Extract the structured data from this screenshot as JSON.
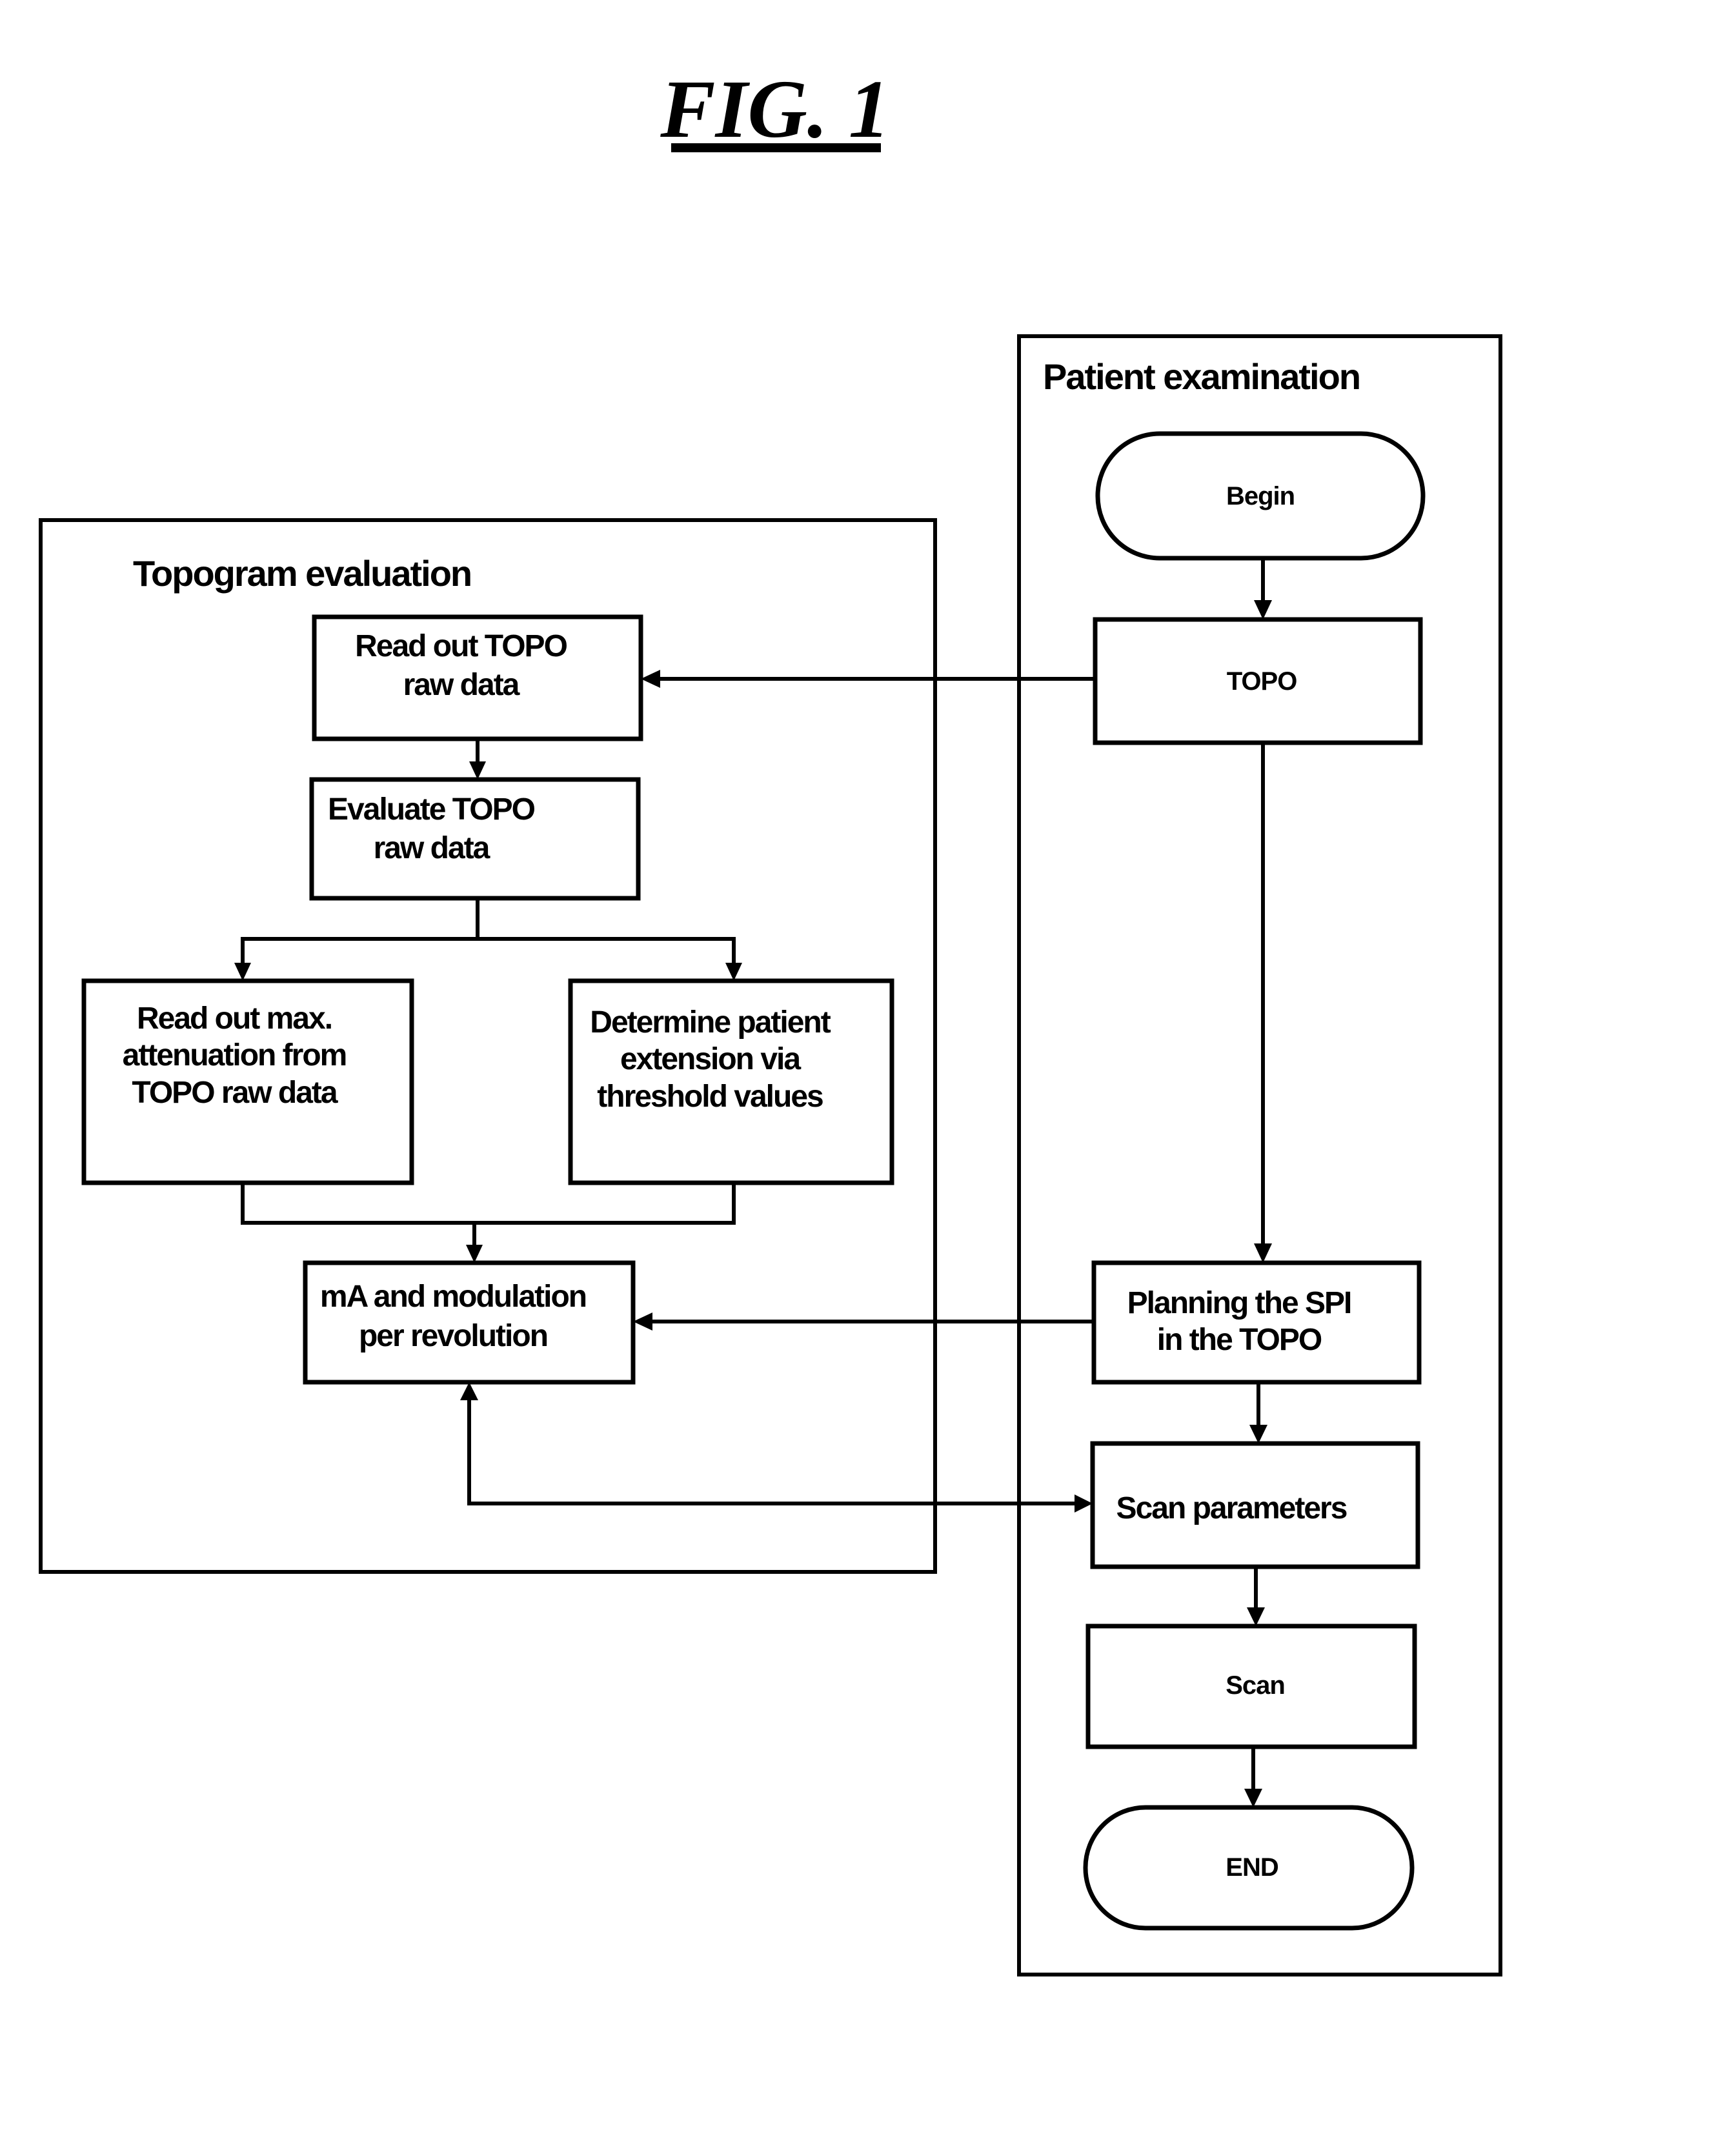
{
  "figure": {
    "title": "FIG. 1"
  },
  "panels": {
    "patient_examination": {
      "label": "Patient examination"
    },
    "topogram_evaluation": {
      "label": "Topogram evaluation"
    }
  },
  "nodes": {
    "begin": {
      "lines": [
        "Begin"
      ],
      "shape": "terminator"
    },
    "topo": {
      "lines": [
        "TOPO"
      ],
      "shape": "process"
    },
    "planning_spi": {
      "lines": [
        "Planning the SPI",
        "in the TOPO"
      ],
      "shape": "process"
    },
    "scan_parameters": {
      "lines": [
        "Scan parameters"
      ],
      "shape": "process"
    },
    "scan": {
      "lines": [
        "Scan"
      ],
      "shape": "process"
    },
    "end": {
      "lines": [
        "END"
      ],
      "shape": "terminator"
    },
    "read_out_topo_raw": {
      "lines": [
        "Read out TOPO",
        "raw data"
      ],
      "shape": "process"
    },
    "evaluate_topo_raw": {
      "lines": [
        "Evaluate TOPO",
        "raw data"
      ],
      "shape": "process"
    },
    "read_out_max_attenuation": {
      "lines": [
        "Read out max.",
        "attenuation from",
        "TOPO raw data"
      ],
      "shape": "process"
    },
    "determine_patient_extension": {
      "lines": [
        "Determine patient",
        "extension via",
        "threshold values"
      ],
      "shape": "process"
    },
    "ma_modulation": {
      "lines": [
        "mA and modulation",
        "per revolution"
      ],
      "shape": "process"
    }
  },
  "edges": [
    {
      "from": "begin",
      "to": "topo"
    },
    {
      "from": "topo",
      "to": "read_out_topo_raw"
    },
    {
      "from": "topo",
      "to": "planning_spi"
    },
    {
      "from": "read_out_topo_raw",
      "to": "evaluate_topo_raw"
    },
    {
      "from": "evaluate_topo_raw",
      "to": "read_out_max_attenuation"
    },
    {
      "from": "evaluate_topo_raw",
      "to": "determine_patient_extension"
    },
    {
      "from": "read_out_max_attenuation",
      "to": "ma_modulation"
    },
    {
      "from": "determine_patient_extension",
      "to": "ma_modulation"
    },
    {
      "from": "planning_spi",
      "to": "ma_modulation"
    },
    {
      "from": "planning_spi",
      "to": "scan_parameters"
    },
    {
      "from": "ma_modulation",
      "to": "scan_parameters",
      "bidirectional": true
    },
    {
      "from": "scan_parameters",
      "to": "scan"
    },
    {
      "from": "scan",
      "to": "end"
    }
  ]
}
